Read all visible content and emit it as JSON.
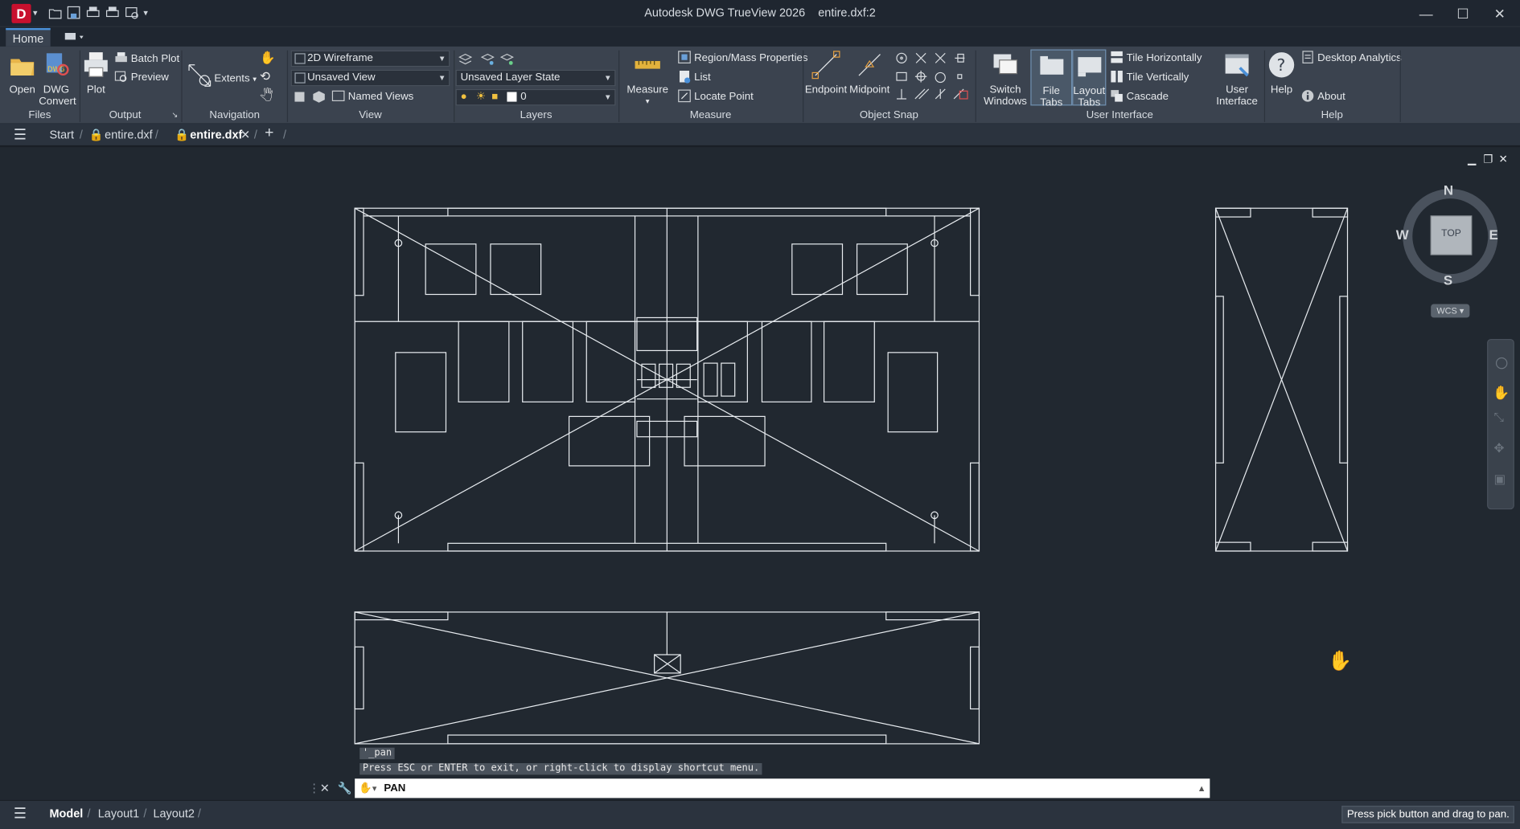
{
  "window": {
    "title": "Autodesk DWG TrueView 2026",
    "filename": "entire.dxf:2",
    "logo_letter": "D",
    "minimize": "—",
    "maximize": "☐",
    "close": "✕"
  },
  "ribbon_tabs": {
    "home": "Home"
  },
  "ribbon": {
    "files": {
      "title": "Files",
      "open": "Open",
      "dwg_convert_1": "DWG",
      "dwg_convert_2": "Convert"
    },
    "output": {
      "title": "Output",
      "plot": "Plot",
      "batch_plot": "Batch Plot",
      "preview": "Preview"
    },
    "navigation": {
      "title": "Navigation",
      "extents": "Extents"
    },
    "view": {
      "title": "View",
      "visual_style": "2D Wireframe",
      "saved_view": "Unsaved View",
      "named_views": "Named Views"
    },
    "layers": {
      "title": "Layers",
      "layer_state": "Unsaved Layer State",
      "current_layer": "0"
    },
    "measure": {
      "title": "Measure",
      "measure": "Measure",
      "region_mass": "Region/Mass Properties",
      "list": "List",
      "locate_point": "Locate Point"
    },
    "object_snap": {
      "title": "Object Snap",
      "endpoint": "Endpoint",
      "midpoint": "Midpoint"
    },
    "user_interface": {
      "title": "User Interface",
      "switch_windows_1": "Switch",
      "switch_windows_2": "Windows",
      "file_tabs": "File Tabs",
      "layout_tabs_1": "Layout",
      "layout_tabs_2": "Tabs",
      "tile_horizontally": "Tile Horizontally",
      "tile_vertically": "Tile Vertically",
      "cascade": "Cascade",
      "user_interface_1": "User",
      "user_interface_2": "Interface"
    },
    "help": {
      "title": "Help",
      "help": "Help",
      "desktop_analytics": "Desktop Analytics",
      "about": "About"
    }
  },
  "doc_tabs": {
    "start": "Start",
    "tab1": "entire.dxf",
    "tab2": "entire.dxf",
    "add": "+"
  },
  "viewcube": {
    "north": "N",
    "south": "S",
    "east": "E",
    "west": "W",
    "face": "TOP",
    "wcs": "WCS"
  },
  "command": {
    "history1": "'_pan",
    "history2": "Press ESC or ENTER to exit, or right-click to display shortcut menu.",
    "current": "PAN"
  },
  "layout_tabs": {
    "model": "Model",
    "layout1": "Layout1",
    "layout2": "Layout2"
  },
  "status": {
    "message": "Press pick button and drag to pan."
  },
  "colors": {
    "canvas": "#212830",
    "ribbon": "#3b434f",
    "accent": "#4a90d9",
    "logo": "#c8102e"
  }
}
